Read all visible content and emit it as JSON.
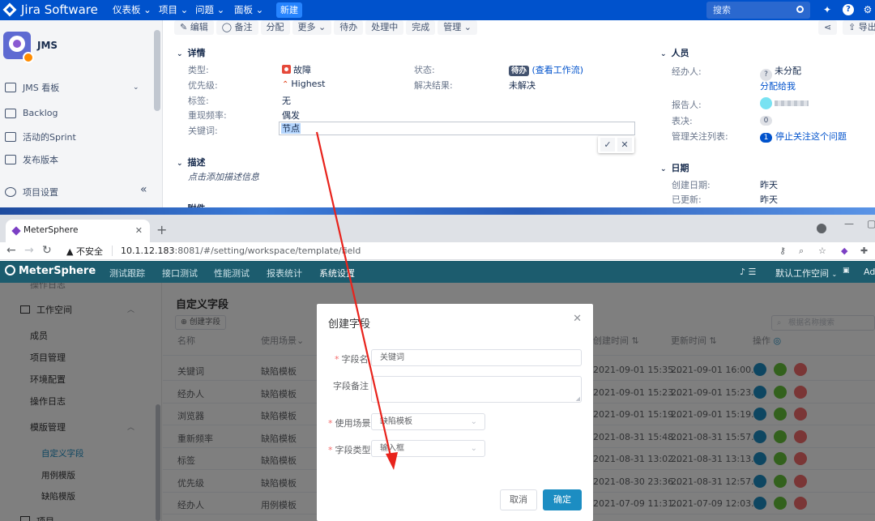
{
  "jira": {
    "logo": "Jira Software",
    "nav": [
      "仪表板 ⌄",
      "项目 ⌄",
      "问题 ⌄",
      "面板 ⌄"
    ],
    "new_button": "新建",
    "search_placeholder": "搜索",
    "project_name": "JMS",
    "sidebar": [
      "JMS 看板",
      "Backlog",
      "活动的Sprint",
      "发布版本",
      "项目设置"
    ],
    "toolbar": [
      "✎ 编辑",
      "◯ 备注",
      "分配",
      "更多 ⌄",
      "待办",
      "处理中",
      "完成",
      "管理 ⌄"
    ],
    "export": "导出",
    "details": {
      "heading": "详情",
      "type_label": "类型:",
      "type_value": "故障",
      "priority_label": "优先级:",
      "priority_value": "Highest",
      "labels_label": "标签:",
      "labels_value": "无",
      "frequency_label": "重现频率:",
      "frequency_value": "偶发",
      "keyword_label": "关键词:",
      "keyword_value": "节点",
      "status_label": "状态:",
      "status_value": "待办",
      "status_link": "(查看工作流)",
      "resolution_label": "解决结果:",
      "resolution_value": "未解决"
    },
    "description": {
      "heading": "描述",
      "placeholder": "点击添加描述信息"
    },
    "attachments_heading": "附件",
    "people": {
      "heading": "人员",
      "assignee_label": "经办人:",
      "assignee_value": "未分配",
      "assign_me": "分配给我",
      "reporter_label": "报告人:",
      "votes_label": "表决:",
      "votes_value": "0",
      "watchers_label": "管理关注列表:",
      "watchers_count": "1",
      "watchers_link": "停止关注这个问题"
    },
    "dates": {
      "heading": "日期",
      "created_label": "创建日期:",
      "created_value": "昨天",
      "updated_label": "已更新:",
      "updated_value": "昨天"
    },
    "collapse_icon": "«"
  },
  "browser": {
    "tab_title": "MeterSphere",
    "insecure": "▲ 不安全",
    "url_host": "10.1.12.183",
    "url_path": ":8081/#/setting/workspace/template/field"
  },
  "ms": {
    "logo": "MeterSphere",
    "nav": [
      "测试跟踪",
      "接口测试",
      "性能测试",
      "报表统计",
      "系统设置"
    ],
    "workspace": "默认工作空间",
    "user_short": "Adr",
    "sidebar": {
      "workspace": "工作空间",
      "items": [
        "成员",
        "项目管理",
        "环境配置",
        "操作日志",
        "模版管理"
      ],
      "template_children": [
        "自定义字段",
        "用例模版",
        "缺陷模版"
      ],
      "bottom": "项目",
      "top_cut": "操作日志"
    },
    "page_title": "自定义字段",
    "create_button": "创建字段",
    "search_placeholder": "根据名称搜索",
    "columns": [
      "名称",
      "使用场景",
      "创建时间",
      "更新时间",
      "操作"
    ],
    "rows": [
      {
        "name": "关键词",
        "scene": "缺陷模板",
        "created": "2021-09-01 15:35...",
        "updated": "2021-09-01 16:00..."
      },
      {
        "name": "经办人",
        "scene": "缺陷模板",
        "created": "2021-09-01 15:23...",
        "updated": "2021-09-01 15:23..."
      },
      {
        "name": "浏览器",
        "scene": "缺陷模板",
        "created": "2021-09-01 15:19...",
        "updated": "2021-09-01 15:19..."
      },
      {
        "name": "重新频率",
        "scene": "缺陷模板",
        "created": "2021-08-31 15:48...",
        "updated": "2021-08-31 15:57..."
      },
      {
        "name": "标签",
        "scene": "缺陷模板",
        "created": "2021-08-31 13:02...",
        "updated": "2021-08-31 13:13..."
      },
      {
        "name": "优先级",
        "scene": "缺陷模板",
        "created": "2021-08-30 23:36...",
        "updated": "2021-08-31 12:57..."
      },
      {
        "name": "经办人",
        "scene": "用例模板",
        "created": "2021-07-09 11:31...",
        "updated": "2021-07-09 12:03..."
      }
    ]
  },
  "modal": {
    "title": "创建字段",
    "name_label": "字段名",
    "name_value": "关键词",
    "remark_label": "字段备注",
    "scene_label": "使用场景",
    "scene_value": "缺陷模板",
    "type_label": "字段类型",
    "type_value": "输入框",
    "cancel": "取消",
    "ok": "确定"
  },
  "colors": {
    "jira_blue": "#0052cc",
    "ms_header": "#1c5c6e",
    "ms_accent": "#1c8dc2",
    "annotation_arrow": "#e8231c"
  }
}
